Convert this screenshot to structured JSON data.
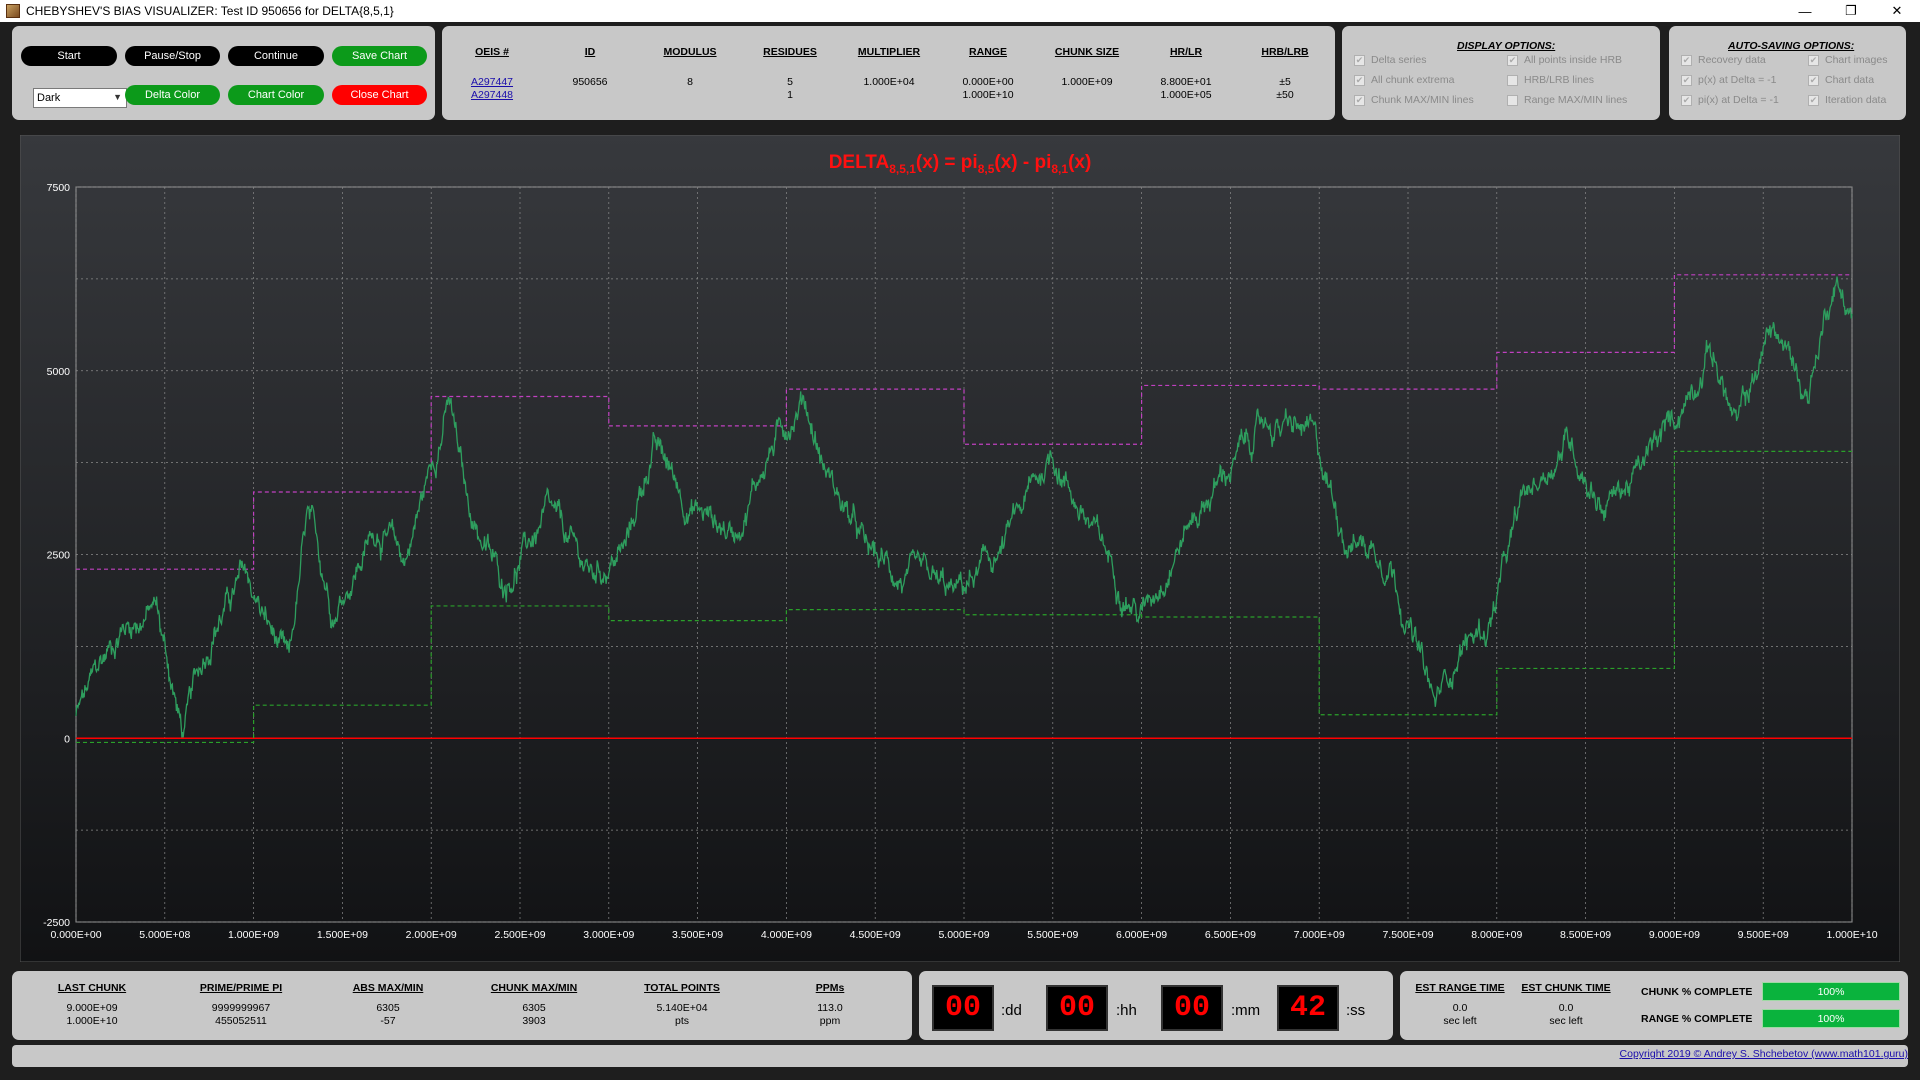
{
  "window": {
    "title": "CHEBYSHEV'S BIAS VISUALIZER: Test ID 950656 for DELTA{8,5,1}",
    "minimize": "—",
    "restore": "❐",
    "close": "✕"
  },
  "controls": {
    "start": "Start",
    "pause": "Pause/Stop",
    "continue": "Continue",
    "save": "Save Chart",
    "theme": "Dark",
    "delta_color": "Delta Color",
    "chart_color": "Chart Color",
    "close_chart": "Close Chart"
  },
  "info": {
    "headers": [
      "OEIS #",
      "ID",
      "MODULUS",
      "RESIDUES",
      "MULTIPLIER",
      "RANGE",
      "CHUNK SIZE",
      "HR/LR",
      "HRB/LRB"
    ],
    "oeis": [
      "A297447",
      "A297448"
    ],
    "id": "950656",
    "modulus": "8",
    "residues": [
      "5",
      "1"
    ],
    "multiplier": "1.000E+04",
    "range": [
      "0.000E+00",
      "1.000E+10"
    ],
    "chunk_size": "1.000E+09",
    "hr_lr": [
      "8.800E+01",
      "1.000E+05"
    ],
    "hrb_lrb": [
      "±5",
      "±50"
    ]
  },
  "display_options": {
    "title": "DISPLAY OPTIONS:",
    "items": [
      "Delta series",
      "All chunk extrema",
      "Chunk MAX/MIN lines",
      "All points inside HRB",
      "HRB/LRB lines",
      "Range MAX/MIN lines"
    ],
    "checked": [
      true,
      true,
      true,
      true,
      false,
      false
    ]
  },
  "autosave_options": {
    "title": "AUTO-SAVING OPTIONS:",
    "items": [
      "Recovery data",
      "p(x) at Delta = -1",
      "pi(x) at Delta = -1",
      "Chart images",
      "Chart data",
      "Iteration data"
    ],
    "checked": [
      true,
      true,
      true,
      true,
      true,
      true
    ]
  },
  "chart_data": {
    "type": "line",
    "title_parts": [
      "DELTA",
      "8,5,1",
      "(x) = pi",
      "8,5",
      "(x) - pi",
      "8,1",
      "(x)"
    ],
    "xlim": [
      0,
      10000000000
    ],
    "ylim": [
      -2500,
      7500
    ],
    "x_ticks": [
      "0.000E+00",
      "5.000E+08",
      "1.000E+09",
      "1.500E+09",
      "2.000E+09",
      "2.500E+09",
      "3.000E+09",
      "3.500E+09",
      "4.000E+09",
      "4.500E+09",
      "5.000E+09",
      "5.500E+09",
      "6.000E+09",
      "6.500E+09",
      "7.000E+09",
      "7.500E+09",
      "8.000E+09",
      "8.500E+09",
      "9.000E+09",
      "9.500E+09",
      "1.000E+10"
    ],
    "y_ticks": [
      "-2500",
      "0",
      "2500",
      "5000",
      "7500"
    ],
    "y_tick_values": [
      -2500,
      0,
      2500,
      5000,
      7500
    ],
    "grid": true,
    "zero_line": 0,
    "delta_keypoints": {
      "x": [
        0,
        250000000.0,
        450000000.0,
        600000000.0,
        780000000.0,
        950000000.0,
        1200000000.0,
        1300000000.0,
        1450000000.0,
        1700000000.0,
        1850000000.0,
        2100000000.0,
        2200000000.0,
        2400000000.0,
        2650000000.0,
        2900000000.0,
        3100000000.0,
        3250000000.0,
        3450000000.0,
        3700000000.0,
        3900000000.0,
        4100000000.0,
        4200000000.0,
        4450000000.0,
        4700000000.0,
        4950000000.0,
        5200000000.0,
        5500000000.0,
        5750000000.0,
        6000000000.0,
        6200000000.0,
        6400000000.0,
        6700000000.0,
        6950000000.0,
        7150000000.0,
        7400000000.0,
        7650000000.0,
        7800000000.0,
        7950000000.0,
        8150000000.0,
        8400000000.0,
        8600000000.0,
        8800000000.0,
        9000000000.0,
        9200000000.0,
        9350000000.0,
        9550000000.0,
        9750000000.0,
        9900000000.0,
        10000000000.0
      ],
      "y": [
        300,
        1500,
        1800,
        60,
        1600,
        2200,
        900,
        2900,
        1800,
        2900,
        2400,
        4600,
        3200,
        2100,
        3000,
        2200,
        2600,
        4000,
        3200,
        2800,
        3900,
        4700,
        3800,
        2500,
        2100,
        1900,
        2500,
        3900,
        2700,
        1700,
        2700,
        3400,
        4300,
        4100,
        2800,
        2500,
        400,
        1300,
        1500,
        3200,
        4100,
        3200,
        3600,
        4300,
        5400,
        4200,
        5600,
        4700,
        6300,
        5800
      ]
    },
    "chunk_max": [
      2300,
      3350,
      4650,
      4250,
      4750,
      4000,
      4800,
      4750,
      5250,
      6305
    ],
    "chunk_min": [
      -57,
      450,
      1800,
      1600,
      1750,
      1680,
      1650,
      320,
      950,
      3903
    ],
    "colors": {
      "delta": "#2e9e5e",
      "max": "#c040c0",
      "min": "#2aa02a",
      "zero": "#ff0000",
      "title": "#ff1010",
      "bg": "#2a2a2e"
    }
  },
  "stats": {
    "headers": [
      "LAST  CHUNK",
      "PRIME/PRIME PI",
      "ABS MAX/MIN",
      "CHUNK  MAX/MIN",
      "TOTAL POINTS",
      "PPMs"
    ],
    "last_chunk": [
      "9.000E+09",
      "1.000E+10"
    ],
    "prime": [
      "9999999967",
      "455052511"
    ],
    "abs": [
      "6305",
      "-57"
    ],
    "chunk": [
      "6305",
      "3903"
    ],
    "total": [
      "5.140E+04",
      "pts"
    ],
    "ppm": [
      "113.0",
      "ppm"
    ]
  },
  "timer": {
    "dd": "00",
    "hh": "00",
    "mm": "00",
    "ss": "42",
    "u_dd": ":dd",
    "u_hh": ":hh",
    "u_mm": ":mm",
    "u_ss": ":ss"
  },
  "est": {
    "range_label": "EST RANGE TIME",
    "chunk_label": "EST CHUNK TIME",
    "range_val": "0.0",
    "chunk_val": "0.0",
    "unit": "sec left"
  },
  "progress": {
    "chunk_label": "CHUNK % COMPLETE",
    "chunk_pct": 100,
    "chunk_text": "100%",
    "range_label": "RANGE % COMPLETE",
    "range_pct": 100,
    "range_text": "100%"
  },
  "copyright": "Copyright 2019 © Andrey S. Shchebetov (www.math101.guru)"
}
